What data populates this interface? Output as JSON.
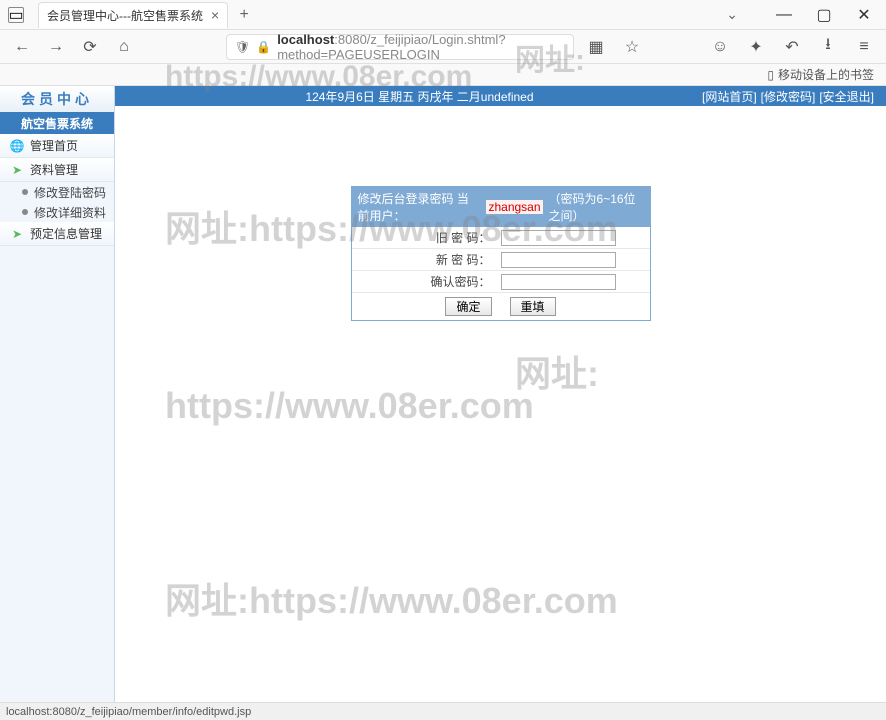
{
  "browser": {
    "tab_title": "会员管理中心---航空售票系统",
    "new_tab": "+",
    "url_host": "localhost",
    "url_path": ":8080/z_feijipiao/Login.shtml?method=PAGEUSERLOGIN",
    "bookmark_mobile": "移动设备上的书签"
  },
  "app": {
    "logo_text": "会员中心",
    "subtitle": "航空售票系统",
    "banner_date": "124年9月6日 星期五 丙戌年 二月undefined",
    "banner_links": [
      "[网站首页]",
      "[修改密码]",
      "[安全退出]"
    ],
    "nav": {
      "home": "管理首页",
      "profile_mgmt": "资料管理",
      "change_pwd": "修改登陆密码",
      "edit_detail": "修改详细资料",
      "booking_mgmt": "预定信息管理"
    }
  },
  "form": {
    "header_prefix": "修改后台登录密码  当前用户：",
    "current_user": "zhangsan",
    "hint": "（密码为6~16位之间）",
    "old_pwd": "旧  密  码：",
    "new_pwd": "新  密  码：",
    "confirm_pwd": "确认密码：",
    "submit": "确定",
    "reset": "重填"
  },
  "watermarks": {
    "wm1": "网址:",
    "wm2": "https://www.08er.com",
    "wm3": "网址:https://www.08er.com",
    "wm4": "网址:",
    "wm5": "https://www.08er.com",
    "wm6": "网址:https://www.08er.com"
  },
  "status_bar": "localhost:8080/z_feijipiao/member/info/editpwd.jsp"
}
